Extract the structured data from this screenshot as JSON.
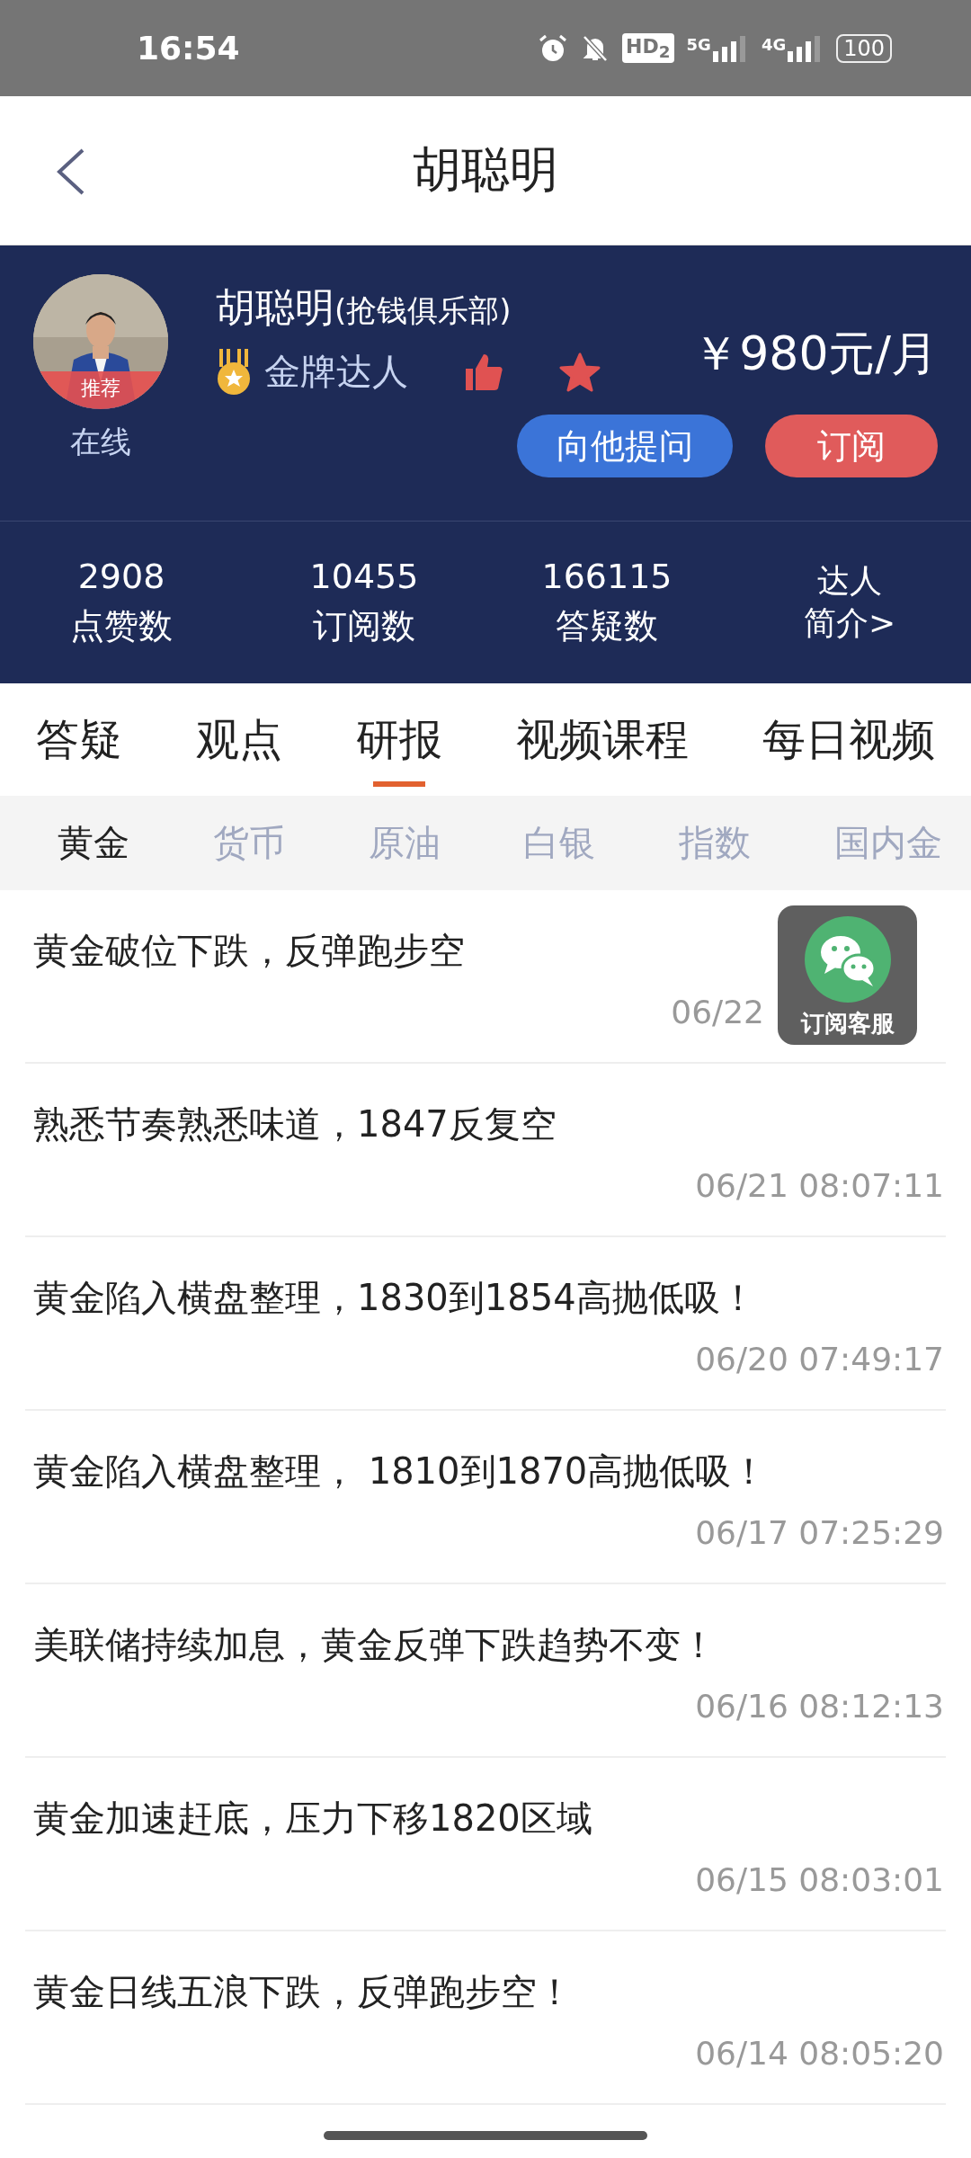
{
  "status_bar": {
    "time": "16:54",
    "hd": "HD$_{2}$",
    "net1": "5G",
    "net2": "4G",
    "battery": "100"
  },
  "header": {
    "title": "胡聪明"
  },
  "profile": {
    "avatar_tag": "推荐",
    "online": "在线",
    "name": "胡聪明",
    "club": "(抢钱俱乐部)",
    "rank": "金牌达人",
    "price": "￥980元/月",
    "ask_button": "向他提问",
    "subscribe_button": "订阅"
  },
  "stats": [
    {
      "value": "2908",
      "label": "点赞数"
    },
    {
      "value": "10455",
      "label": "订阅数"
    },
    {
      "value": "166115",
      "label": "答疑数"
    }
  ],
  "intro_link": [
    "达人",
    "简介>"
  ],
  "tabs": [
    {
      "label": "答疑",
      "selected": false
    },
    {
      "label": "观点",
      "selected": false
    },
    {
      "label": "研报",
      "selected": true
    },
    {
      "label": "视频课程",
      "selected": false
    },
    {
      "label": "每日视频",
      "selected": false
    }
  ],
  "subtabs": [
    {
      "label": "黄金",
      "selected": true
    },
    {
      "label": "货币",
      "selected": false
    },
    {
      "label": "原油",
      "selected": false
    },
    {
      "label": "白银",
      "selected": false
    },
    {
      "label": "指数",
      "selected": false
    },
    {
      "label": "国内金",
      "selected": false
    }
  ],
  "articles": [
    {
      "title": "黄金破位下跌，反弹跑步空",
      "date": "06/22"
    },
    {
      "title": "熟悉节奏熟悉味道，1847反复空",
      "date": "06/21 08:07:11"
    },
    {
      "title": "黄金陷入横盘整理，1830到1854高抛低吸！",
      "date": "06/20 07:49:17"
    },
    {
      "title": "黄金陷入横盘整理， 1810到1870高抛低吸！",
      "date": "06/17 07:25:29"
    },
    {
      "title": "美联储持续加息，黄金反弹下跌趋势不变！",
      "date": "06/16 08:12:13"
    },
    {
      "title": "黄金加速赶底，压力下移1820区域",
      "date": "06/15 08:03:01"
    },
    {
      "title": "黄金日线五浪下跌，反弹跑步空！",
      "date": "06/14 08:05:20"
    }
  ],
  "float_button": {
    "label": "订阅客服"
  }
}
